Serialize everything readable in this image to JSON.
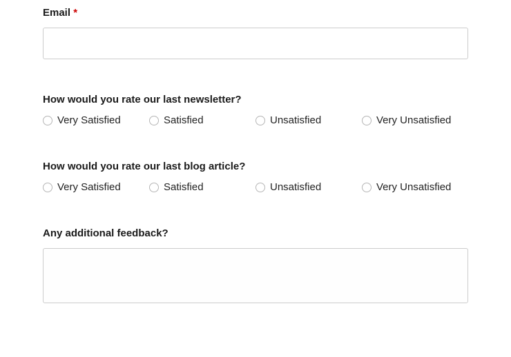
{
  "email": {
    "label": "Email",
    "required_marker": "*",
    "value": ""
  },
  "q_newsletter": {
    "label": "How would you rate our last newsletter?",
    "options": [
      "Very Satisfied",
      "Satisfied",
      "Unsatisfied",
      "Very Unsatisfied"
    ]
  },
  "q_blog": {
    "label": "How would you rate our last blog article?",
    "options": [
      "Very Satisfied",
      "Satisfied",
      "Unsatisfied",
      "Very Unsatisfied"
    ]
  },
  "q_feedback": {
    "label": "Any additional feedback?",
    "value": ""
  }
}
